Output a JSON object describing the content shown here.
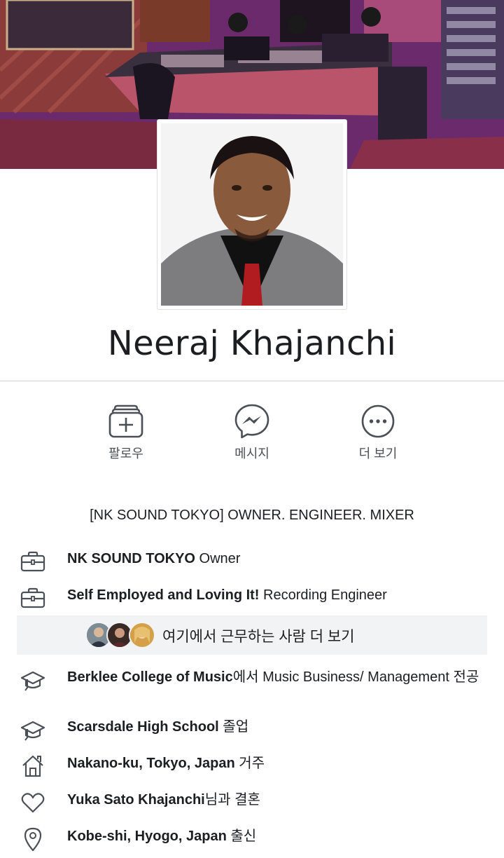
{
  "profile": {
    "name": "Neeraj Khajanchi",
    "headline": "[NK SOUND TOKYO] OWNER. ENGINEER. MIXER"
  },
  "actions": [
    {
      "label": "팔로우",
      "icon": "follow-icon"
    },
    {
      "label": "메시지",
      "icon": "messenger-icon"
    },
    {
      "label": "더 보기",
      "icon": "more-icon"
    }
  ],
  "about": {
    "work": [
      {
        "bold": "NK SOUND TOKYO",
        "rest": " Owner",
        "icon": "briefcase-icon"
      },
      {
        "bold": "Self Employed and Loving It!",
        "rest": " Recording Engineer",
        "icon": "briefcase-icon"
      }
    ],
    "coworkers_link": "여기에서 근무하는 사람 더 보기",
    "education": [
      {
        "bold": "Berklee College of Music",
        "rest": "에서 Music Business/ Management 전공",
        "icon": "graduation-cap-icon"
      },
      {
        "bold": "Scarsdale High School",
        "rest": " 졸업",
        "icon": "graduation-cap-icon"
      }
    ],
    "lives": {
      "bold": "Nakano-ku, Tokyo, Japan",
      "rest": " 거주",
      "icon": "home-icon"
    },
    "relationship": {
      "bold": "Yuka Sato Khajanchi",
      "rest": "님과 결혼",
      "icon": "heart-icon"
    },
    "hometown": {
      "bold": "Kobe-shi, Hyogo, Japan",
      "rest": " 출신",
      "icon": "location-pin-icon"
    }
  },
  "colors": {
    "icon": "#4b4f56",
    "text": "#1c1e21",
    "panel": "#f2f3f5"
  }
}
